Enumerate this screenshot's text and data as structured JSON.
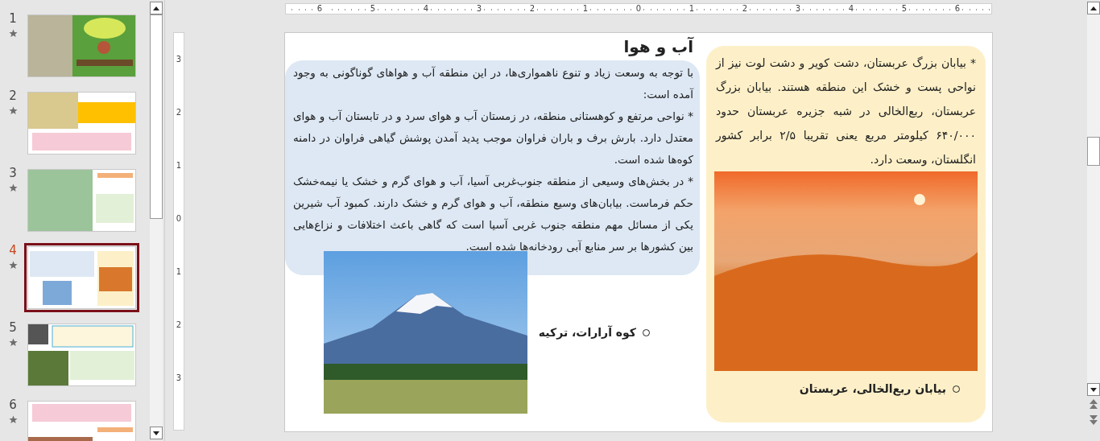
{
  "thumbnails": [
    {
      "number": "1",
      "selected": false
    },
    {
      "number": "2",
      "selected": false
    },
    {
      "number": "3",
      "selected": false
    },
    {
      "number": "4",
      "selected": true
    },
    {
      "number": "5",
      "selected": false
    },
    {
      "number": "6",
      "selected": false
    }
  ],
  "rulers": {
    "horizontal": [
      "6",
      "5",
      "4",
      "3",
      "2",
      "1",
      "0",
      "1",
      "2",
      "3",
      "4",
      "5",
      "6"
    ],
    "vertical": [
      "3",
      "2",
      "1",
      "0",
      "1",
      "2",
      "3"
    ]
  },
  "slide": {
    "title": "آب و هوا",
    "left_box": {
      "paragraphs": [
        "با توجه به وسعت زیاد و تنوع ناهمواری‌ها، در این منطقه آب و هواهای گوناگونی به وجود آمده است:",
        "* نواحی مرتفع و کوهستانی منطقه، در زمستان آب و هوای سرد و در تابستان آب و هوای معتدل دارد. بارش برف و باران فراوان موجب پدید آمدن پوشش گیاهی فراوان در دامنه کوه‌ها شده است.",
        "* در بخش‌های وسیعی از منطقه جنوب‌غربی آسیا، آب و هوای گرم و خشک یا نیمه‌خشک حکم فرماست. بیابان‌های وسیع منطقه، آب و هوای گرم و خشک دارند. کمبود آب شیرین یکی از مسائل مهم منطقه جنوب غربی آسیا است که گاهی باعث اختلافات و نزاع‌هایی بین کشورها بر سر منابع آبی رودخانه‌ها شده است."
      ]
    },
    "left_caption": "کوه آرارات، ترکیه",
    "right_box": {
      "paragraph": "* بیابان بزرگ عربستان، دشت کویر و دشت لوت نیز از نواحی پست و خشک این منطقه هستند. بیابان بزرگ عربستان، ربع‌الخالی در شبه جزیره عربستان حدود ۶۴۰/۰۰۰ کیلومتر مربع یعنی تقریبا ۲/۵ برابر کشور انگلستان، وسعت دارد."
    },
    "right_caption": "بیابان ربع‌الخالی، عربستان"
  }
}
